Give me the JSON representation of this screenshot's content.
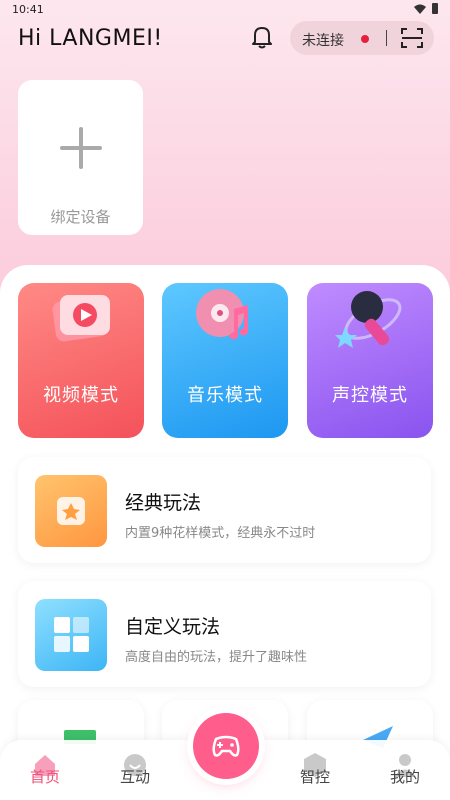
{
  "status_bar": {
    "time": "10:41"
  },
  "header": {
    "greeting": "Hi LANGMEI!",
    "connection_status": "未连接",
    "status_dot_color": "#e5203a"
  },
  "bind_device": {
    "label": "绑定设备"
  },
  "modes": [
    {
      "label": "视频模式",
      "icon": "video-play-icon",
      "color": "#f4525a"
    },
    {
      "label": "音乐模式",
      "icon": "music-disc-icon",
      "color": "#1d97f1"
    },
    {
      "label": "声控模式",
      "icon": "microphone-icon",
      "color": "#8a53ef"
    }
  ],
  "play_cards": [
    {
      "title": "经典玩法",
      "desc": "内置9种花样模式，经典永不过时",
      "icon": "star-tile-icon"
    },
    {
      "title": "自定义玩法",
      "desc": "高度自由的玩法，提升了趣味性",
      "icon": "grid-tile-icon"
    }
  ],
  "tabbar": {
    "items": [
      {
        "label": "首页",
        "icon": "home-icon",
        "active": true
      },
      {
        "label": "互动",
        "icon": "interact-icon",
        "active": false
      },
      {
        "label": "智控",
        "icon": "ai-icon",
        "active": false
      },
      {
        "label": "我的",
        "icon": "profile-icon",
        "active": false
      }
    ],
    "center_icon": "gamepad-icon",
    "accent_color": "#f05077"
  }
}
